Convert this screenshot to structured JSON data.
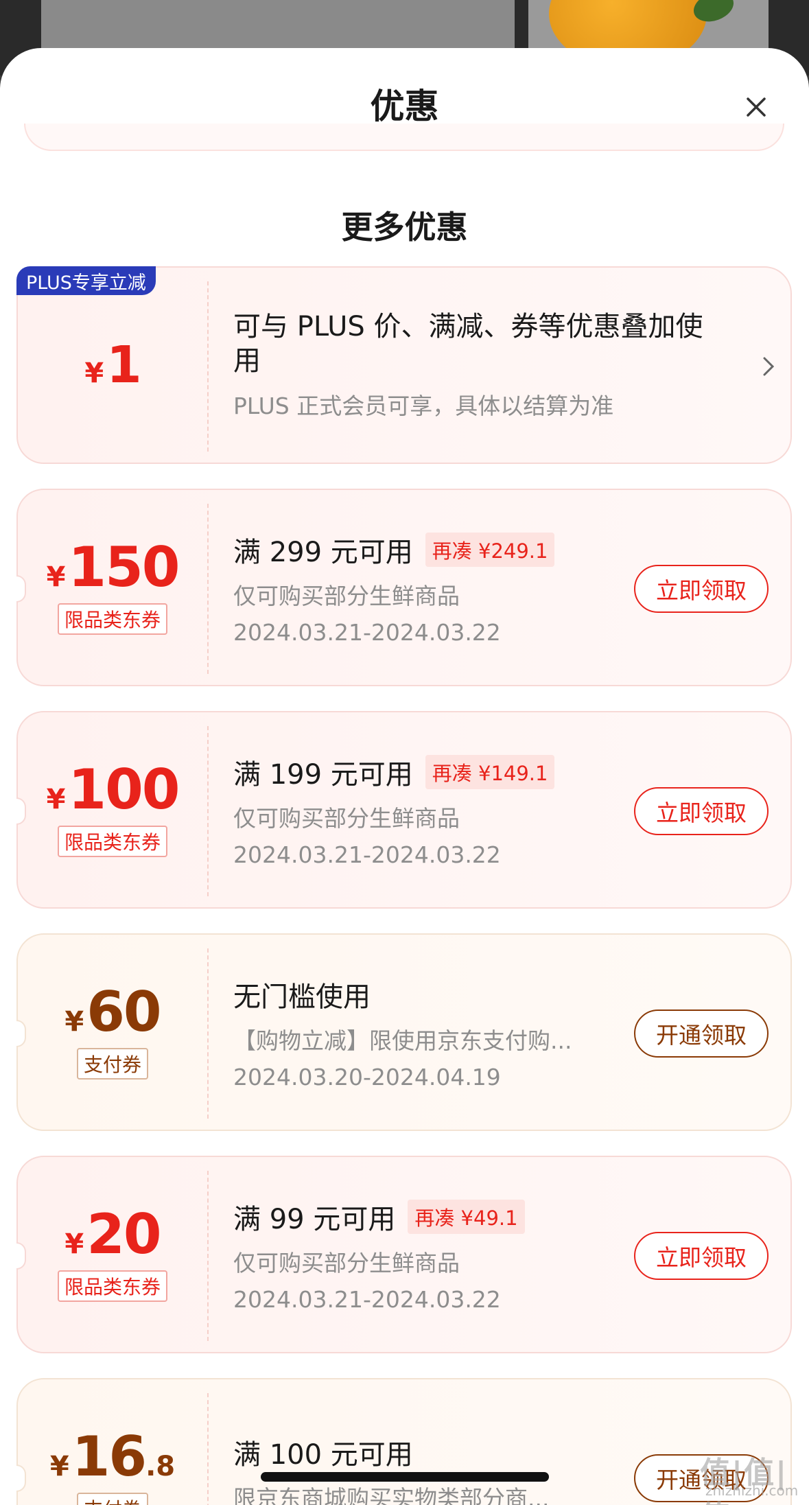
{
  "sheet": {
    "title": "优惠",
    "section_title": "更多优惠"
  },
  "plus": {
    "badge": "PLUS专享立减",
    "currency": "¥",
    "amount": "1",
    "main": "可与 PLUS 价、满减、券等优惠叠加使用",
    "sub": "PLUS 正式会员可享，具体以结算为准"
  },
  "coupons": [
    {
      "currency": "¥",
      "amount": "150",
      "decimal": "",
      "tag": "限品类东券",
      "condition": "满 299 元可用",
      "gap": "再凑 ¥249.1",
      "desc": "仅可购买部分生鲜商品",
      "date": "2024.03.21-2024.03.22",
      "action": "立即领取"
    },
    {
      "currency": "¥",
      "amount": "100",
      "decimal": "",
      "tag": "限品类东券",
      "condition": "满 199 元可用",
      "gap": "再凑 ¥149.1",
      "desc": "仅可购买部分生鲜商品",
      "date": "2024.03.21-2024.03.22",
      "action": "立即领取"
    },
    {
      "currency": "¥",
      "amount": "60",
      "decimal": "",
      "tag": "支付券",
      "condition": "无门槛使用",
      "gap": "",
      "desc": "【购物立减】限使用京东支付购...",
      "date": "2024.03.20-2024.04.19",
      "action": "开通领取"
    },
    {
      "currency": "¥",
      "amount": "20",
      "decimal": "",
      "tag": "限品类东券",
      "condition": "满 99 元可用",
      "gap": "再凑 ¥49.1",
      "desc": "仅可购买部分生鲜商品",
      "date": "2024.03.21-2024.03.22",
      "action": "立即领取"
    },
    {
      "currency": "¥",
      "amount": "16",
      "decimal": ".8",
      "tag": "支付券",
      "condition": "满 100 元可用",
      "gap": "",
      "desc": "限京东商城购买实物类部分商...",
      "date": "",
      "action": "开通领取"
    }
  ],
  "watermark": {
    "main": "值|值|值",
    "sub": "zhizhizhi.com"
  },
  "colors": {
    "accent_red": "#e8231b",
    "accent_brown": "#8a3a06",
    "plus_blue": "#2a3bb8"
  }
}
